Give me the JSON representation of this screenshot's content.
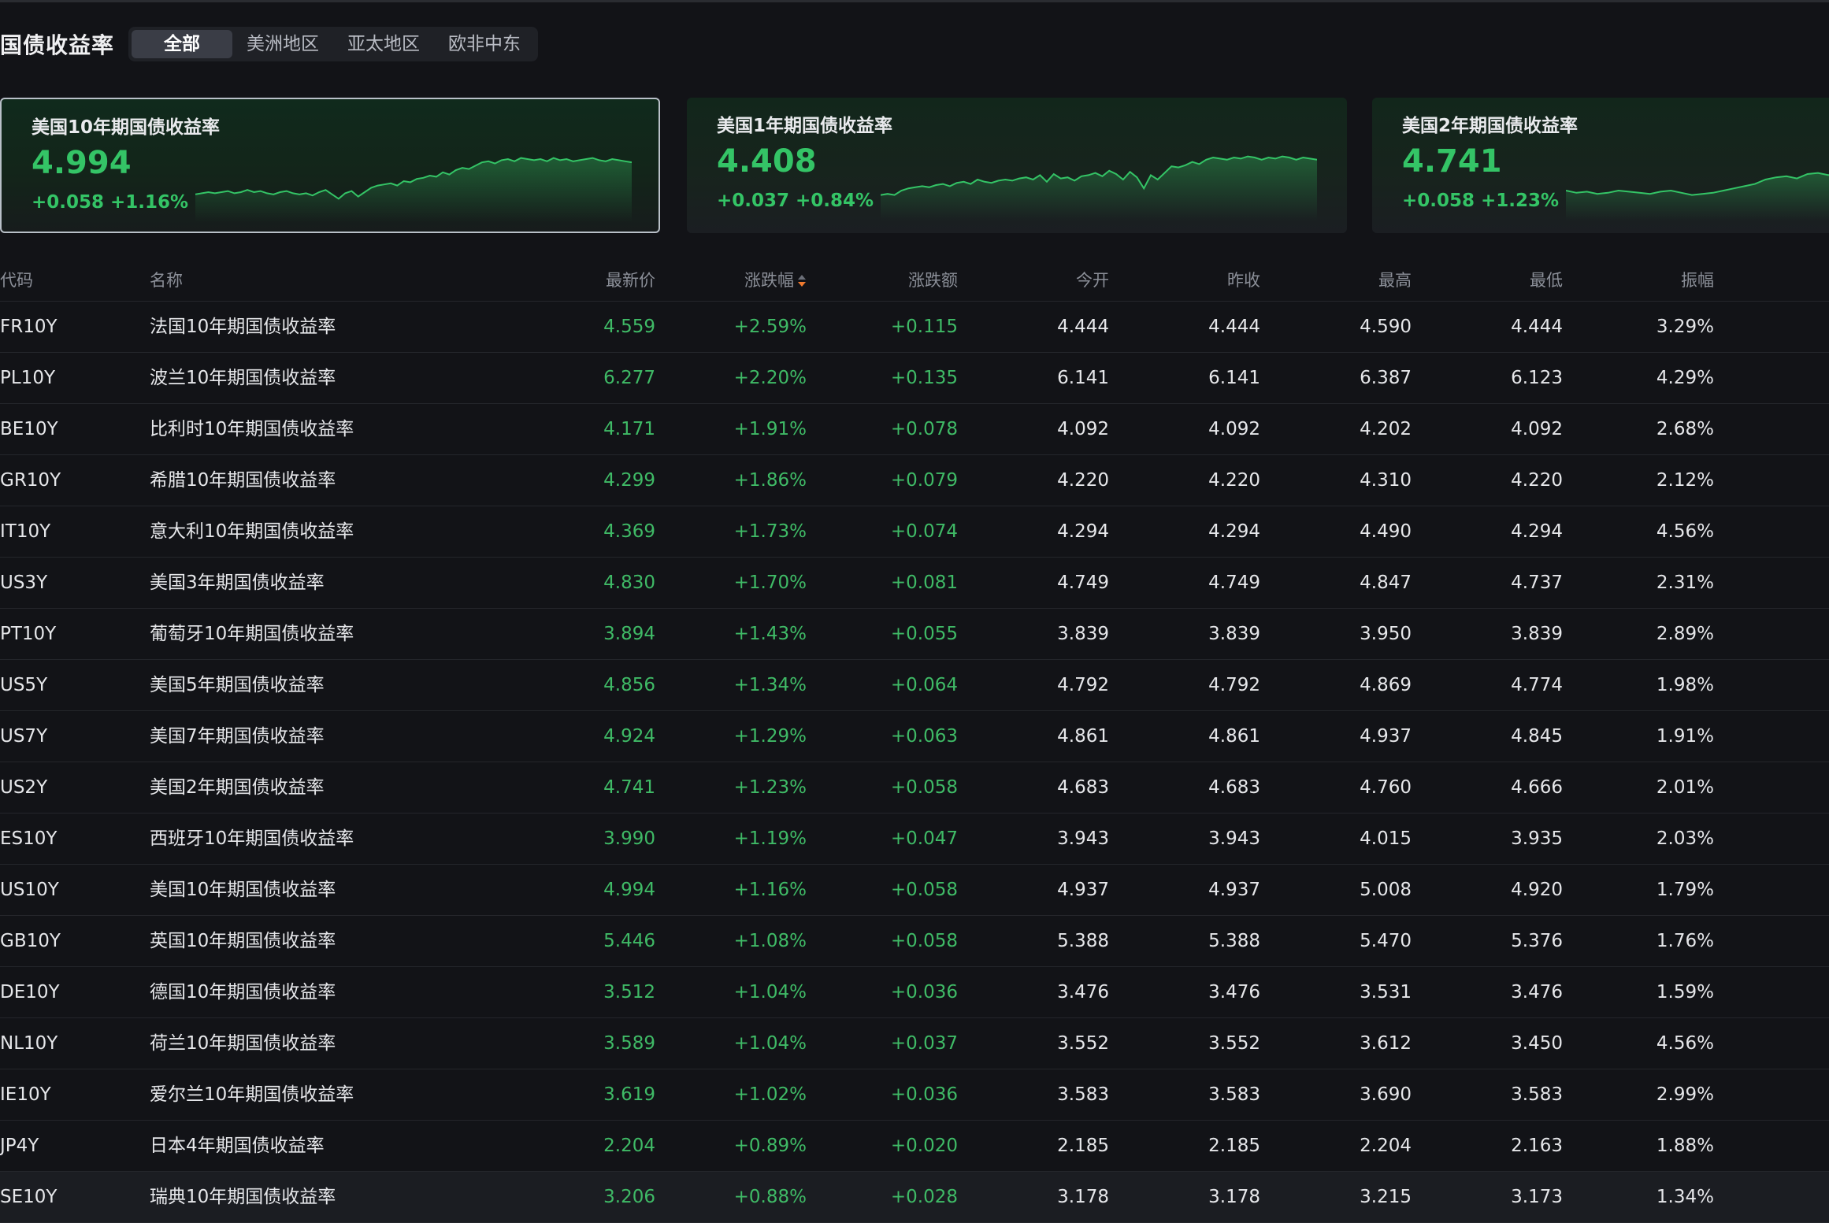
{
  "header": {
    "title": "国债收益率",
    "tabs": [
      {
        "label": "全部",
        "active": true
      },
      {
        "label": "美洲地区",
        "active": false
      },
      {
        "label": "亚太地区",
        "active": false
      },
      {
        "label": "欧非中东",
        "active": false
      }
    ]
  },
  "cards": [
    {
      "name": "美国10年期国债收益率",
      "price": "4.994",
      "change": "+0.058",
      "change_pct": "+1.16%",
      "selected": true,
      "spark": [
        42,
        41,
        40,
        41,
        40,
        39,
        41,
        40,
        38,
        40,
        39,
        41,
        42,
        40,
        39,
        41,
        42,
        41,
        43,
        40,
        38,
        42,
        46,
        41,
        39,
        44,
        40,
        36,
        34,
        33,
        32,
        34,
        30,
        31,
        28,
        27,
        25,
        26,
        22,
        24,
        20,
        18,
        19,
        16,
        13,
        12,
        14,
        11,
        10,
        12,
        9,
        10,
        11,
        10,
        12,
        9,
        11,
        10,
        12,
        11,
        10,
        9,
        11,
        12,
        10,
        11,
        12,
        13
      ]
    },
    {
      "name": "美国1年期国债收益率",
      "price": "4.408",
      "change": "+0.037",
      "change_pct": "+0.84%",
      "selected": false,
      "spark": [
        44,
        43,
        44,
        40,
        38,
        37,
        36,
        37,
        35,
        34,
        36,
        33,
        32,
        34,
        30,
        32,
        33,
        31,
        30,
        31,
        29,
        28,
        30,
        26,
        32,
        25,
        29,
        28,
        31,
        27,
        26,
        24,
        27,
        22,
        25,
        30,
        23,
        28,
        38,
        26,
        30,
        24,
        18,
        19,
        17,
        14,
        16,
        12,
        10,
        11,
        12,
        10,
        11,
        9,
        10,
        12,
        10,
        11,
        9,
        10,
        12,
        10,
        11,
        12
      ]
    },
    {
      "name": "美国2年期国债收益率",
      "price": "4.741",
      "change": "+0.058",
      "change_pct": "+1.23%",
      "selected": false,
      "spark": [
        40,
        42,
        41,
        43,
        42,
        40,
        41,
        42,
        43,
        41,
        40,
        42,
        44,
        43,
        42,
        40,
        38,
        36,
        34,
        30,
        28,
        27,
        29,
        25,
        24,
        26,
        23,
        22
      ]
    }
  ],
  "table": {
    "columns": {
      "code": "代码",
      "name": "名称",
      "last": "最新价",
      "change_pct": "涨跌幅",
      "change": "涨跌额",
      "open": "今开",
      "prev_close": "昨收",
      "high": "最高",
      "low": "最低",
      "amplitude": "振幅"
    },
    "rows": [
      {
        "code": "FR10Y",
        "name": "法国10年期国债收益率",
        "last": "4.559",
        "change_pct": "+2.59%",
        "change": "+0.115",
        "open": "4.444",
        "prev_close": "4.444",
        "high": "4.590",
        "low": "4.444",
        "amplitude": "3.29%"
      },
      {
        "code": "PL10Y",
        "name": "波兰10年期国债收益率",
        "last": "6.277",
        "change_pct": "+2.20%",
        "change": "+0.135",
        "open": "6.141",
        "prev_close": "6.141",
        "high": "6.387",
        "low": "6.123",
        "amplitude": "4.29%"
      },
      {
        "code": "BE10Y",
        "name": "比利时10年期国债收益率",
        "last": "4.171",
        "change_pct": "+1.91%",
        "change": "+0.078",
        "open": "4.092",
        "prev_close": "4.092",
        "high": "4.202",
        "low": "4.092",
        "amplitude": "2.68%"
      },
      {
        "code": "GR10Y",
        "name": "希腊10年期国债收益率",
        "last": "4.299",
        "change_pct": "+1.86%",
        "change": "+0.079",
        "open": "4.220",
        "prev_close": "4.220",
        "high": "4.310",
        "low": "4.220",
        "amplitude": "2.12%"
      },
      {
        "code": "IT10Y",
        "name": "意大利10年期国债收益率",
        "last": "4.369",
        "change_pct": "+1.73%",
        "change": "+0.074",
        "open": "4.294",
        "prev_close": "4.294",
        "high": "4.490",
        "low": "4.294",
        "amplitude": "4.56%"
      },
      {
        "code": "US3Y",
        "name": "美国3年期国债收益率",
        "last": "4.830",
        "change_pct": "+1.70%",
        "change": "+0.081",
        "open": "4.749",
        "prev_close": "4.749",
        "high": "4.847",
        "low": "4.737",
        "amplitude": "2.31%"
      },
      {
        "code": "PT10Y",
        "name": "葡萄牙10年期国债收益率",
        "last": "3.894",
        "change_pct": "+1.43%",
        "change": "+0.055",
        "open": "3.839",
        "prev_close": "3.839",
        "high": "3.950",
        "low": "3.839",
        "amplitude": "2.89%"
      },
      {
        "code": "US5Y",
        "name": "美国5年期国债收益率",
        "last": "4.856",
        "change_pct": "+1.34%",
        "change": "+0.064",
        "open": "4.792",
        "prev_close": "4.792",
        "high": "4.869",
        "low": "4.774",
        "amplitude": "1.98%"
      },
      {
        "code": "US7Y",
        "name": "美国7年期国债收益率",
        "last": "4.924",
        "change_pct": "+1.29%",
        "change": "+0.063",
        "open": "4.861",
        "prev_close": "4.861",
        "high": "4.937",
        "low": "4.845",
        "amplitude": "1.91%"
      },
      {
        "code": "US2Y",
        "name": "美国2年期国债收益率",
        "last": "4.741",
        "change_pct": "+1.23%",
        "change": "+0.058",
        "open": "4.683",
        "prev_close": "4.683",
        "high": "4.760",
        "low": "4.666",
        "amplitude": "2.01%"
      },
      {
        "code": "ES10Y",
        "name": "西班牙10年期国债收益率",
        "last": "3.990",
        "change_pct": "+1.19%",
        "change": "+0.047",
        "open": "3.943",
        "prev_close": "3.943",
        "high": "4.015",
        "low": "3.935",
        "amplitude": "2.03%"
      },
      {
        "code": "US10Y",
        "name": "美国10年期国债收益率",
        "last": "4.994",
        "change_pct": "+1.16%",
        "change": "+0.058",
        "open": "4.937",
        "prev_close": "4.937",
        "high": "5.008",
        "low": "4.920",
        "amplitude": "1.79%"
      },
      {
        "code": "GB10Y",
        "name": "英国10年期国债收益率",
        "last": "5.446",
        "change_pct": "+1.08%",
        "change": "+0.058",
        "open": "5.388",
        "prev_close": "5.388",
        "high": "5.470",
        "low": "5.376",
        "amplitude": "1.76%"
      },
      {
        "code": "DE10Y",
        "name": "德国10年期国债收益率",
        "last": "3.512",
        "change_pct": "+1.04%",
        "change": "+0.036",
        "open": "3.476",
        "prev_close": "3.476",
        "high": "3.531",
        "low": "3.476",
        "amplitude": "1.59%"
      },
      {
        "code": "NL10Y",
        "name": "荷兰10年期国债收益率",
        "last": "3.589",
        "change_pct": "+1.04%",
        "change": "+0.037",
        "open": "3.552",
        "prev_close": "3.552",
        "high": "3.612",
        "low": "3.450",
        "amplitude": "4.56%"
      },
      {
        "code": "IE10Y",
        "name": "爱尔兰10年期国债收益率",
        "last": "3.619",
        "change_pct": "+1.02%",
        "change": "+0.036",
        "open": "3.583",
        "prev_close": "3.583",
        "high": "3.690",
        "low": "3.583",
        "amplitude": "2.99%"
      },
      {
        "code": "JP4Y",
        "name": "日本4年期国债收益率",
        "last": "2.204",
        "change_pct": "+0.89%",
        "change": "+0.020",
        "open": "2.185",
        "prev_close": "2.185",
        "high": "2.204",
        "low": "2.163",
        "amplitude": "1.88%"
      },
      {
        "code": "SE10Y",
        "name": "瑞典10年期国债收益率",
        "last": "3.206",
        "change_pct": "+0.88%",
        "change": "+0.028",
        "open": "3.178",
        "prev_close": "3.178",
        "high": "3.215",
        "low": "3.173",
        "amplitude": "1.34%"
      }
    ]
  },
  "colors": {
    "up": "#3fba66",
    "card_up": "#34c466",
    "background": "#121317",
    "sort_active": "#f07a2e"
  }
}
